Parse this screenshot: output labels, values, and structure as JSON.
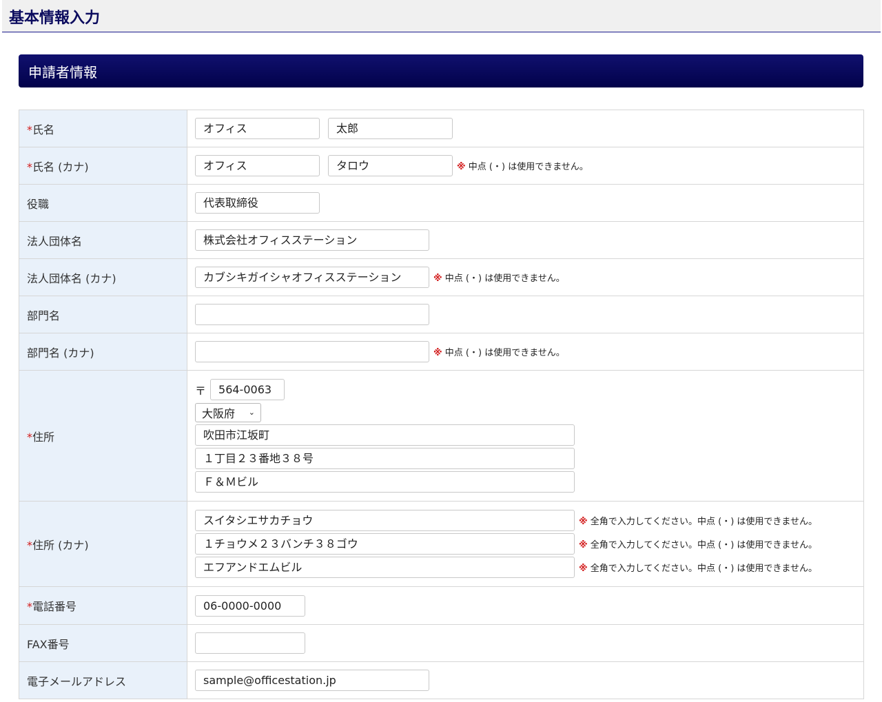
{
  "page_title": "基本情報入力",
  "section_title": "申請者情報",
  "required_mark": "*",
  "note_mark": "※",
  "notes": {
    "nakaten": "中点 (・) は使用できません。",
    "zenkaku": "全角で入力してください。中点 (・) は使用できません。"
  },
  "fields": {
    "name": {
      "label": "氏名",
      "last": "オフィス",
      "first": "太郎"
    },
    "name_kana": {
      "label": "氏名 (カナ)",
      "last": "オフィス",
      "first": "タロウ"
    },
    "title": {
      "label": "役職",
      "value": "代表取締役"
    },
    "corp": {
      "label": "法人団体名",
      "value": "株式会社オフィスステーション"
    },
    "corp_kana": {
      "label": "法人団体名 (カナ)",
      "value": "カブシキガイシャオフィスステーション"
    },
    "dept": {
      "label": "部門名",
      "value": ""
    },
    "dept_kana": {
      "label": "部門名 (カナ)",
      "value": ""
    },
    "address": {
      "label": "住所",
      "zip_prefix": "〒",
      "zip": "564-0063",
      "prefecture": "大阪府",
      "line1": "吹田市江坂町",
      "line2": "１丁目２３番地３８号",
      "line3": "Ｆ＆Ｍビル"
    },
    "address_kana": {
      "label": "住所 (カナ)",
      "line1": "スイタシエサカチョウ",
      "line2": "１チョウメ２３バンチ３８ゴウ",
      "line3": "エフアンドエムビル"
    },
    "tel": {
      "label": "電話番号",
      "value": "06-0000-0000"
    },
    "fax": {
      "label": "FAX番号",
      "value": ""
    },
    "email": {
      "label": "電子メールアドレス",
      "value": "sample@officestation.jp"
    }
  }
}
